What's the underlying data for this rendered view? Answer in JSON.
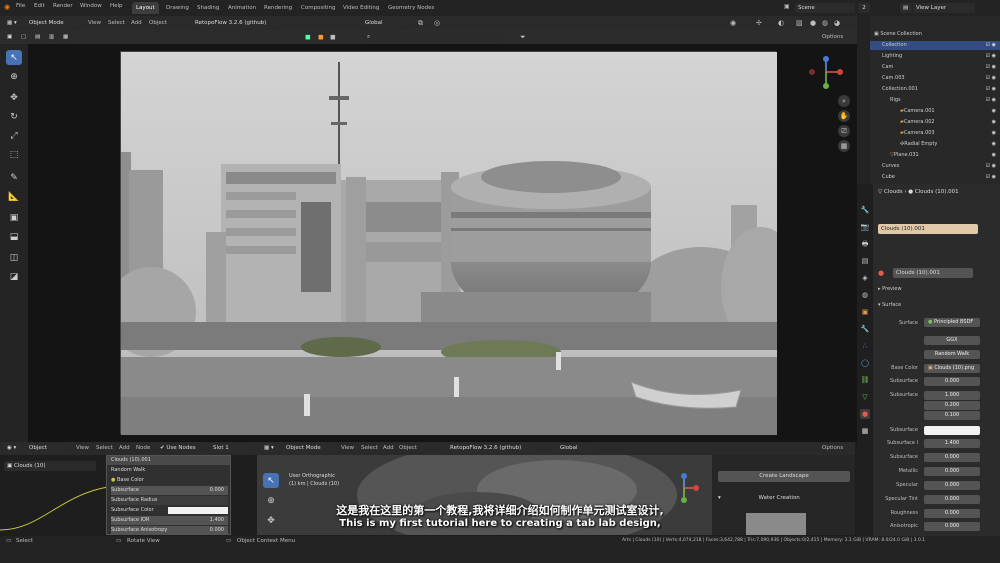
{
  "topbar": {
    "menus": [
      "File",
      "Edit",
      "Render",
      "Window",
      "Help"
    ],
    "workspaces": [
      "Layout",
      "Drawing",
      "Shading",
      "Animation",
      "Rendering",
      "Compositing",
      "Video Editing",
      "Geometry Nodes"
    ],
    "active_workspace": "Layout",
    "scene": "Scene",
    "scene_users": "2",
    "view_layer": "View Layer"
  },
  "viewport_header": {
    "mode": "Object Mode",
    "menus": [
      "View",
      "Select",
      "Add",
      "Object"
    ],
    "addon": "RetopoFlow 3.2.6 (github)",
    "orientation": "Global",
    "options": "Options"
  },
  "outliner": {
    "title": "Scene Collection",
    "rows": [
      {
        "label": "Collection",
        "indent": 1,
        "selected": false
      },
      {
        "label": "Lighting",
        "indent": 1,
        "selected": false
      },
      {
        "label": "Cam",
        "indent": 1,
        "selected": false
      },
      {
        "label": "Cam.003",
        "indent": 1,
        "selected": false
      },
      {
        "label": "Collection.001",
        "indent": 1,
        "selected": false
      },
      {
        "label": "Rigs",
        "indent": 2,
        "selected": false
      },
      {
        "label": "Camera.001",
        "indent": 3,
        "selected": false
      },
      {
        "label": "Camera.002",
        "indent": 3,
        "selected": false
      },
      {
        "label": "Camera.003",
        "indent": 3,
        "selected": false
      },
      {
        "label": "Radial Empty",
        "indent": 3,
        "selected": false
      },
      {
        "label": "Plane.031",
        "indent": 2,
        "selected": false
      },
      {
        "label": "Curves",
        "indent": 1,
        "selected": false
      },
      {
        "label": "Cube",
        "indent": 1,
        "selected": false
      }
    ]
  },
  "properties": {
    "breadcrumb_object": "Clouds",
    "breadcrumb_material": "Clouds (10).001",
    "material_slot": "Clouds (10).001",
    "material_name": "Clouds (10).001",
    "preview_label": "Preview",
    "surface_header": "Surface",
    "surface_label": "Surface",
    "surface_value": "Principled BSDF",
    "distribution": "GGX",
    "subsurface_method": "Random Walk",
    "base_color_label": "Base Color",
    "base_color_value": "Clouds (10).png",
    "fields": [
      {
        "label": "Subsurface",
        "value": "0.000"
      },
      {
        "label": "Subsurface",
        "value": "1.000"
      },
      {
        "label": "",
        "value": "0.200"
      },
      {
        "label": "",
        "value": "0.100"
      },
      {
        "label": "Subsurface",
        "value": ""
      },
      {
        "label": "Subsurface I",
        "value": "1.400"
      },
      {
        "label": "Subsurface",
        "value": "0.000"
      },
      {
        "label": "Metallic",
        "value": "0.000"
      },
      {
        "label": "Specular",
        "value": "0.000"
      },
      {
        "label": "Specular Tint",
        "value": "0.000"
      },
      {
        "label": "Roughness",
        "value": "0.000"
      },
      {
        "label": "Anisotropic",
        "value": "0.000"
      }
    ]
  },
  "node_editor": {
    "type": "Object",
    "menus": [
      "View",
      "Select",
      "Add",
      "Node"
    ],
    "use_nodes": "Use Nodes",
    "slot": "Slot 1",
    "material": "Clouds (10)",
    "node_rows": [
      {
        "label": "Random Walk",
        "value": ""
      },
      {
        "label": "Base Color",
        "value": ""
      },
      {
        "label": "Subsurface",
        "value": "0.000"
      },
      {
        "label": "Subsurface Radius",
        "value": ""
      },
      {
        "label": "Subsurface Color",
        "value": ""
      },
      {
        "label": "Subsurface IOR",
        "value": "1.400"
      },
      {
        "label": "Subsurface Anisotropy",
        "value": "0.000"
      }
    ],
    "node_title": "Clouds (10).001"
  },
  "mini_viewport": {
    "mode": "Object Mode",
    "menus": [
      "View",
      "Select",
      "Add",
      "Object"
    ],
    "addon": "RetopoFlow 3.2.6 (github)",
    "orientation": "Global",
    "options": "Options",
    "view_name": "User Orthographic",
    "view_sub": "(1) km | Clouds (10)"
  },
  "addon_panel": {
    "create_landscape": "Create Landscape",
    "water_creation": "Water Creation"
  },
  "subtitles": {
    "chinese": "这是我在这里的第一个教程,我将详细介绍如何制作单元测试室设计,",
    "english": "This is my first tutorial here to creating a tab lab design,"
  },
  "statusbar": {
    "select": "Select",
    "rotate": "Rotate View",
    "context": "Object Context Menu",
    "stats": "Arts | Clouds (10) | Verts:4,074,218 | Faces:3,642,788 | Tris:7,090,936 | Objects:0/2,415 | Memory: 3.1 GiB | VRAM: 8.0/24.0 GiB | 3.0.1"
  },
  "colors": {
    "accent": "#4772b3",
    "panel": "#2b2b2b",
    "selection": "#334d80"
  }
}
